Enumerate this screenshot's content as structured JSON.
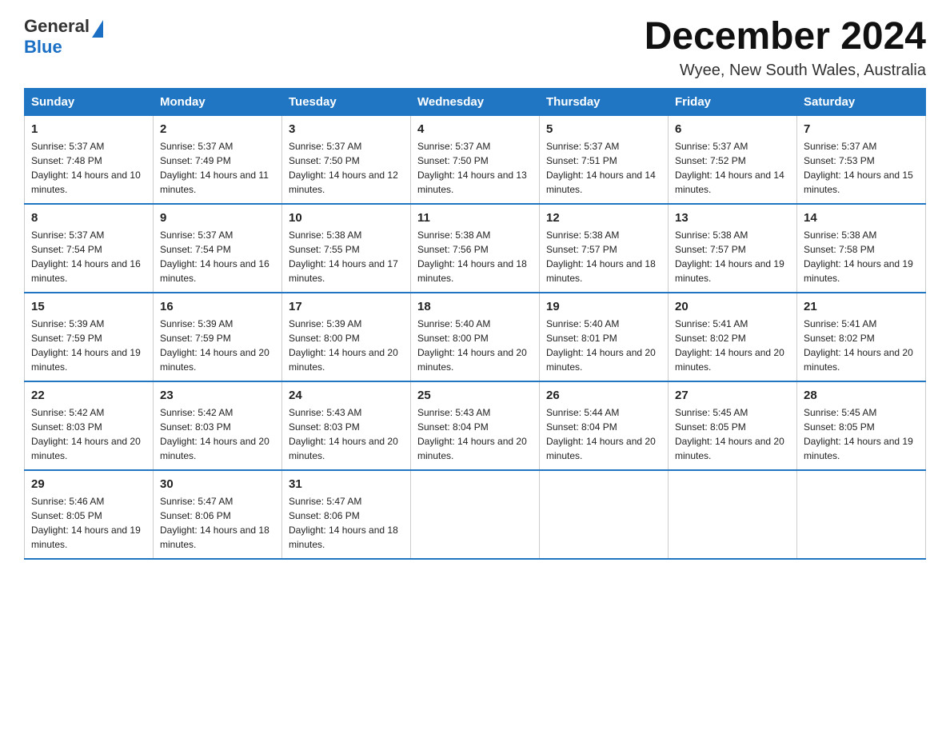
{
  "header": {
    "month_title": "December 2024",
    "location": "Wyee, New South Wales, Australia",
    "logo_general": "General",
    "logo_blue": "Blue"
  },
  "weekdays": [
    "Sunday",
    "Monday",
    "Tuesday",
    "Wednesday",
    "Thursday",
    "Friday",
    "Saturday"
  ],
  "weeks": [
    [
      {
        "day": "1",
        "sunrise": "5:37 AM",
        "sunset": "7:48 PM",
        "daylight": "14 hours and 10 minutes."
      },
      {
        "day": "2",
        "sunrise": "5:37 AM",
        "sunset": "7:49 PM",
        "daylight": "14 hours and 11 minutes."
      },
      {
        "day": "3",
        "sunrise": "5:37 AM",
        "sunset": "7:50 PM",
        "daylight": "14 hours and 12 minutes."
      },
      {
        "day": "4",
        "sunrise": "5:37 AM",
        "sunset": "7:50 PM",
        "daylight": "14 hours and 13 minutes."
      },
      {
        "day": "5",
        "sunrise": "5:37 AM",
        "sunset": "7:51 PM",
        "daylight": "14 hours and 14 minutes."
      },
      {
        "day": "6",
        "sunrise": "5:37 AM",
        "sunset": "7:52 PM",
        "daylight": "14 hours and 14 minutes."
      },
      {
        "day": "7",
        "sunrise": "5:37 AM",
        "sunset": "7:53 PM",
        "daylight": "14 hours and 15 minutes."
      }
    ],
    [
      {
        "day": "8",
        "sunrise": "5:37 AM",
        "sunset": "7:54 PM",
        "daylight": "14 hours and 16 minutes."
      },
      {
        "day": "9",
        "sunrise": "5:37 AM",
        "sunset": "7:54 PM",
        "daylight": "14 hours and 16 minutes."
      },
      {
        "day": "10",
        "sunrise": "5:38 AM",
        "sunset": "7:55 PM",
        "daylight": "14 hours and 17 minutes."
      },
      {
        "day": "11",
        "sunrise": "5:38 AM",
        "sunset": "7:56 PM",
        "daylight": "14 hours and 18 minutes."
      },
      {
        "day": "12",
        "sunrise": "5:38 AM",
        "sunset": "7:57 PM",
        "daylight": "14 hours and 18 minutes."
      },
      {
        "day": "13",
        "sunrise": "5:38 AM",
        "sunset": "7:57 PM",
        "daylight": "14 hours and 19 minutes."
      },
      {
        "day": "14",
        "sunrise": "5:38 AM",
        "sunset": "7:58 PM",
        "daylight": "14 hours and 19 minutes."
      }
    ],
    [
      {
        "day": "15",
        "sunrise": "5:39 AM",
        "sunset": "7:59 PM",
        "daylight": "14 hours and 19 minutes."
      },
      {
        "day": "16",
        "sunrise": "5:39 AM",
        "sunset": "7:59 PM",
        "daylight": "14 hours and 20 minutes."
      },
      {
        "day": "17",
        "sunrise": "5:39 AM",
        "sunset": "8:00 PM",
        "daylight": "14 hours and 20 minutes."
      },
      {
        "day": "18",
        "sunrise": "5:40 AM",
        "sunset": "8:00 PM",
        "daylight": "14 hours and 20 minutes."
      },
      {
        "day": "19",
        "sunrise": "5:40 AM",
        "sunset": "8:01 PM",
        "daylight": "14 hours and 20 minutes."
      },
      {
        "day": "20",
        "sunrise": "5:41 AM",
        "sunset": "8:02 PM",
        "daylight": "14 hours and 20 minutes."
      },
      {
        "day": "21",
        "sunrise": "5:41 AM",
        "sunset": "8:02 PM",
        "daylight": "14 hours and 20 minutes."
      }
    ],
    [
      {
        "day": "22",
        "sunrise": "5:42 AM",
        "sunset": "8:03 PM",
        "daylight": "14 hours and 20 minutes."
      },
      {
        "day": "23",
        "sunrise": "5:42 AM",
        "sunset": "8:03 PM",
        "daylight": "14 hours and 20 minutes."
      },
      {
        "day": "24",
        "sunrise": "5:43 AM",
        "sunset": "8:03 PM",
        "daylight": "14 hours and 20 minutes."
      },
      {
        "day": "25",
        "sunrise": "5:43 AM",
        "sunset": "8:04 PM",
        "daylight": "14 hours and 20 minutes."
      },
      {
        "day": "26",
        "sunrise": "5:44 AM",
        "sunset": "8:04 PM",
        "daylight": "14 hours and 20 minutes."
      },
      {
        "day": "27",
        "sunrise": "5:45 AM",
        "sunset": "8:05 PM",
        "daylight": "14 hours and 20 minutes."
      },
      {
        "day": "28",
        "sunrise": "5:45 AM",
        "sunset": "8:05 PM",
        "daylight": "14 hours and 19 minutes."
      }
    ],
    [
      {
        "day": "29",
        "sunrise": "5:46 AM",
        "sunset": "8:05 PM",
        "daylight": "14 hours and 19 minutes."
      },
      {
        "day": "30",
        "sunrise": "5:47 AM",
        "sunset": "8:06 PM",
        "daylight": "14 hours and 18 minutes."
      },
      {
        "day": "31",
        "sunrise": "5:47 AM",
        "sunset": "8:06 PM",
        "daylight": "14 hours and 18 minutes."
      },
      null,
      null,
      null,
      null
    ]
  ]
}
